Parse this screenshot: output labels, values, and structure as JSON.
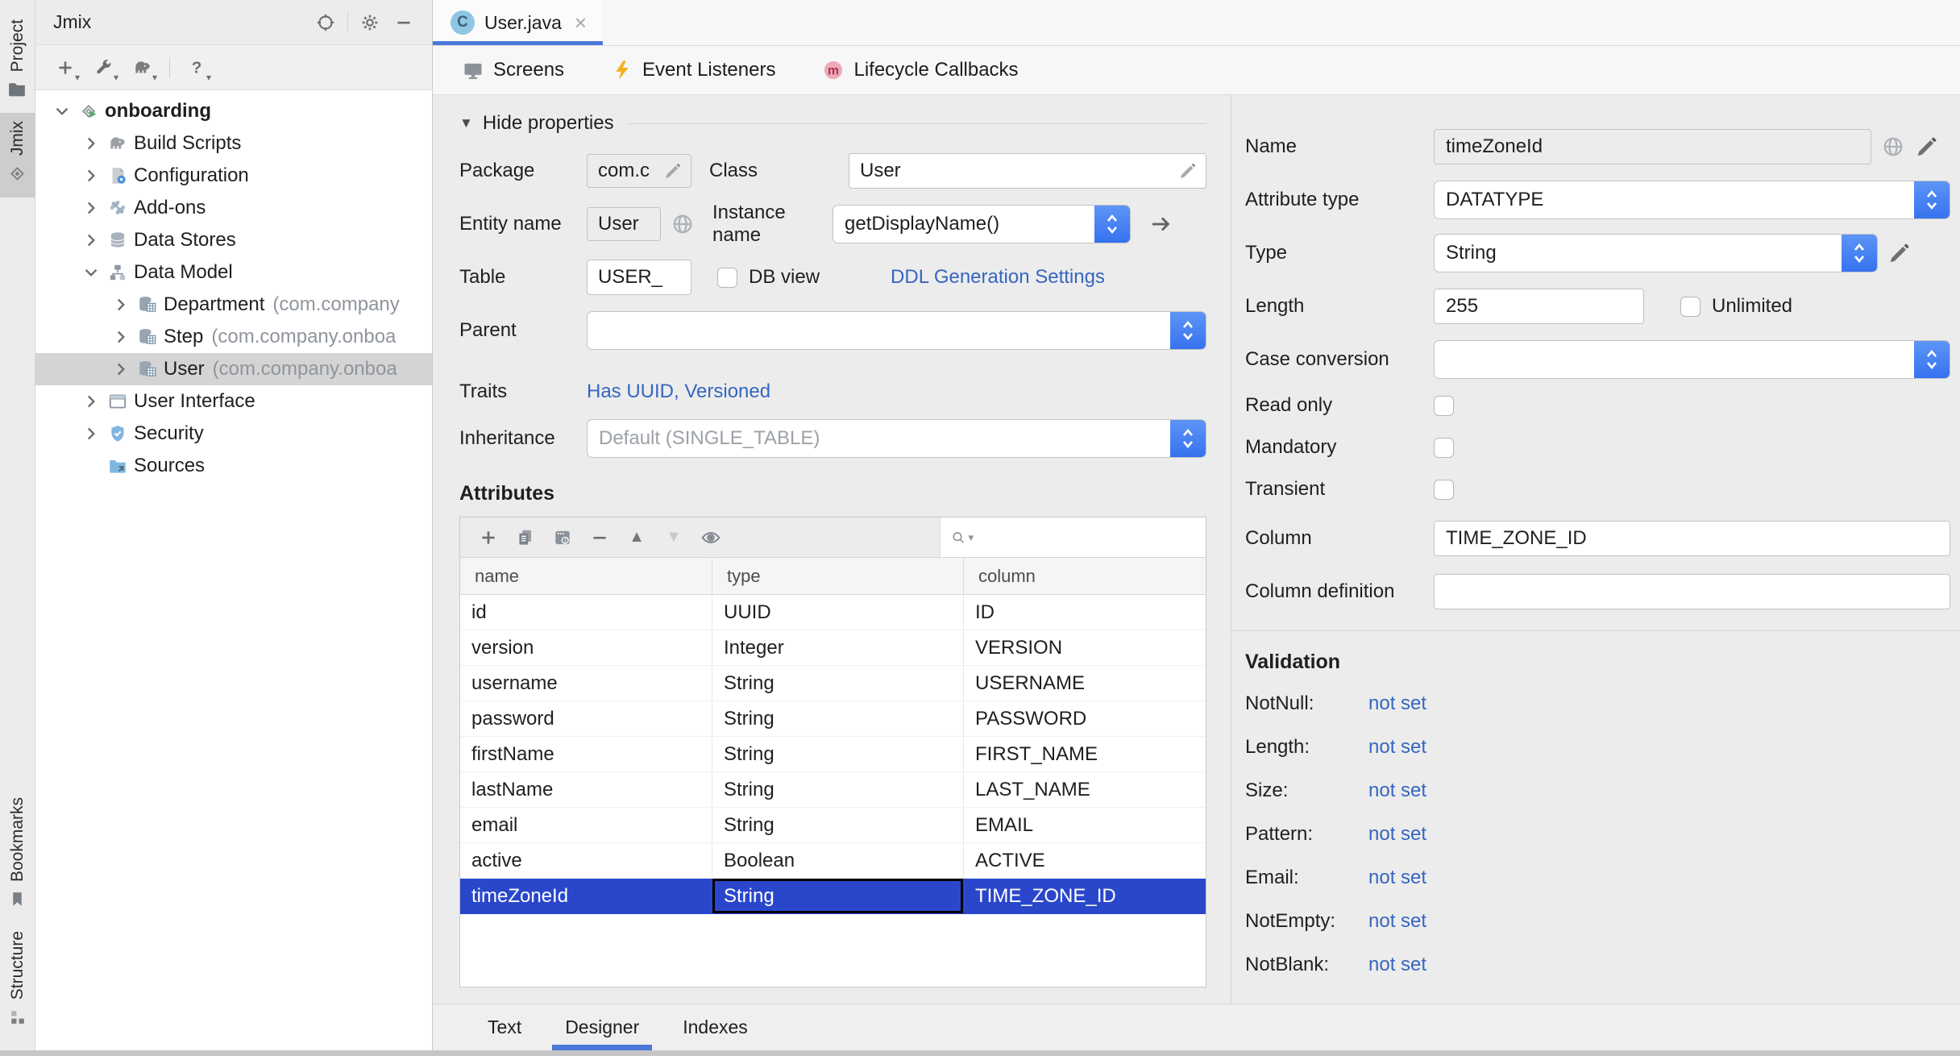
{
  "colors": {
    "accent_blue": "#3672ef",
    "selection_blue": "#2a47cb",
    "link_blue": "#3566c0",
    "tab_underline": "#4a78d8",
    "tree_selection_gray": "#d4d4d4"
  },
  "tool_strip": {
    "top": [
      {
        "label": "Project",
        "icon": "folder-icon",
        "selected": false
      },
      {
        "label": "Jmix",
        "icon": "jmix-icon",
        "selected": true
      }
    ],
    "bottom": [
      {
        "label": "Bookmarks",
        "icon": "bookmark-icon",
        "selected": false
      },
      {
        "label": "Structure",
        "icon": "structure-icon",
        "selected": false
      }
    ]
  },
  "project_panel": {
    "title": "Jmix",
    "tree": [
      {
        "label": "onboarding",
        "suffix": "",
        "icon": "jmix-project",
        "chevron": "down",
        "level": 0,
        "bold": true,
        "selected": false
      },
      {
        "label": "Build Scripts",
        "suffix": "",
        "icon": "gradle",
        "chevron": "right",
        "level": 1,
        "bold": false,
        "selected": false
      },
      {
        "label": "Configuration",
        "suffix": "",
        "icon": "config",
        "chevron": "right",
        "level": 1,
        "bold": false,
        "selected": false
      },
      {
        "label": "Add-ons",
        "suffix": "",
        "icon": "addons",
        "chevron": "right",
        "level": 1,
        "bold": false,
        "selected": false
      },
      {
        "label": "Data Stores",
        "suffix": "",
        "icon": "datastore",
        "chevron": "right",
        "level": 1,
        "bold": false,
        "selected": false
      },
      {
        "label": "Data Model",
        "suffix": "",
        "icon": "datamodel",
        "chevron": "down",
        "level": 1,
        "bold": false,
        "selected": false
      },
      {
        "label": "Department",
        "suffix": "(com.company",
        "icon": "entity",
        "chevron": "right",
        "level": 2,
        "bold": false,
        "selected": false
      },
      {
        "label": "Step",
        "suffix": "(com.company.onboa",
        "icon": "entity",
        "chevron": "right",
        "level": 2,
        "bold": false,
        "selected": false
      },
      {
        "label": "User",
        "suffix": "(com.company.onboa",
        "icon": "entity",
        "chevron": "right",
        "level": 2,
        "bold": false,
        "selected": true
      },
      {
        "label": "User Interface",
        "suffix": "",
        "icon": "ui",
        "chevron": "right",
        "level": 1,
        "bold": false,
        "selected": false
      },
      {
        "label": "Security",
        "suffix": "",
        "icon": "shield",
        "chevron": "right",
        "level": 1,
        "bold": false,
        "selected": false
      },
      {
        "label": "Sources",
        "suffix": "",
        "icon": "sources",
        "chevron": "none",
        "level": 1,
        "bold": false,
        "selected": false
      }
    ]
  },
  "editor": {
    "tab": {
      "title": "User.java",
      "icon_letter": "C"
    },
    "toolbar": [
      {
        "label": "Screens",
        "icon": "screens-icon"
      },
      {
        "label": "Event Listeners",
        "icon": "bolt-icon"
      },
      {
        "label": "Lifecycle Callbacks",
        "icon": "method-icon"
      }
    ],
    "bottom_tabs": [
      {
        "label": "Text",
        "active": false
      },
      {
        "label": "Designer",
        "active": true
      },
      {
        "label": "Indexes",
        "active": false
      }
    ]
  },
  "form": {
    "hide_properties": "Hide properties",
    "package": {
      "label": "Package",
      "value": "com.c"
    },
    "class": {
      "label": "Class",
      "value": "User"
    },
    "entity_name": {
      "label": "Entity name",
      "value": "User"
    },
    "instance_name": {
      "label": "Instance name",
      "value": "getDisplayName()"
    },
    "table": {
      "label": "Table",
      "value": "USER_"
    },
    "db_view": {
      "label": "DB view",
      "checked": false
    },
    "ddl_link": "DDL Generation Settings",
    "parent": {
      "label": "Parent",
      "value": ""
    },
    "traits": {
      "label": "Traits",
      "value": "Has UUID, Versioned"
    },
    "inheritance": {
      "label": "Inheritance",
      "value": "Default (SINGLE_TABLE)"
    },
    "attributes_heading": "Attributes"
  },
  "attributes": {
    "columns": [
      "name",
      "type",
      "column"
    ],
    "rows": [
      {
        "name": "id",
        "type": "UUID",
        "column": "ID",
        "selected": false
      },
      {
        "name": "version",
        "type": "Integer",
        "column": "VERSION",
        "selected": false
      },
      {
        "name": "username",
        "type": "String",
        "column": "USERNAME",
        "selected": false
      },
      {
        "name": "password",
        "type": "String",
        "column": "PASSWORD",
        "selected": false
      },
      {
        "name": "firstName",
        "type": "String",
        "column": "FIRST_NAME",
        "selected": false
      },
      {
        "name": "lastName",
        "type": "String",
        "column": "LAST_NAME",
        "selected": false
      },
      {
        "name": "email",
        "type": "String",
        "column": "EMAIL",
        "selected": false
      },
      {
        "name": "active",
        "type": "Boolean",
        "column": "ACTIVE",
        "selected": false
      },
      {
        "name": "timeZoneId",
        "type": "String",
        "column": "TIME_ZONE_ID",
        "selected": true
      }
    ],
    "search_value": ""
  },
  "inspector": {
    "name": {
      "label": "Name",
      "value": "timeZoneId"
    },
    "attribute_type": {
      "label": "Attribute type",
      "value": "DATATYPE"
    },
    "type": {
      "label": "Type",
      "value": "String"
    },
    "length": {
      "label": "Length",
      "value": "255"
    },
    "unlimited": {
      "label": "Unlimited",
      "checked": false
    },
    "case_conversion": {
      "label": "Case conversion",
      "value": ""
    },
    "read_only": {
      "label": "Read only",
      "checked": false
    },
    "mandatory": {
      "label": "Mandatory",
      "checked": false
    },
    "transient": {
      "label": "Transient",
      "checked": false
    },
    "column": {
      "label": "Column",
      "value": "TIME_ZONE_ID"
    },
    "column_definition": {
      "label": "Column definition",
      "value": ""
    }
  },
  "validation": {
    "heading": "Validation",
    "items": [
      {
        "label": "NotNull:",
        "value": "not set"
      },
      {
        "label": "Length:",
        "value": "not set"
      },
      {
        "label": "Size:",
        "value": "not set"
      },
      {
        "label": "Pattern:",
        "value": "not set"
      },
      {
        "label": "Email:",
        "value": "not set"
      },
      {
        "label": "NotEmpty:",
        "value": "not set"
      },
      {
        "label": "NotBlank:",
        "value": "not set"
      }
    ]
  }
}
